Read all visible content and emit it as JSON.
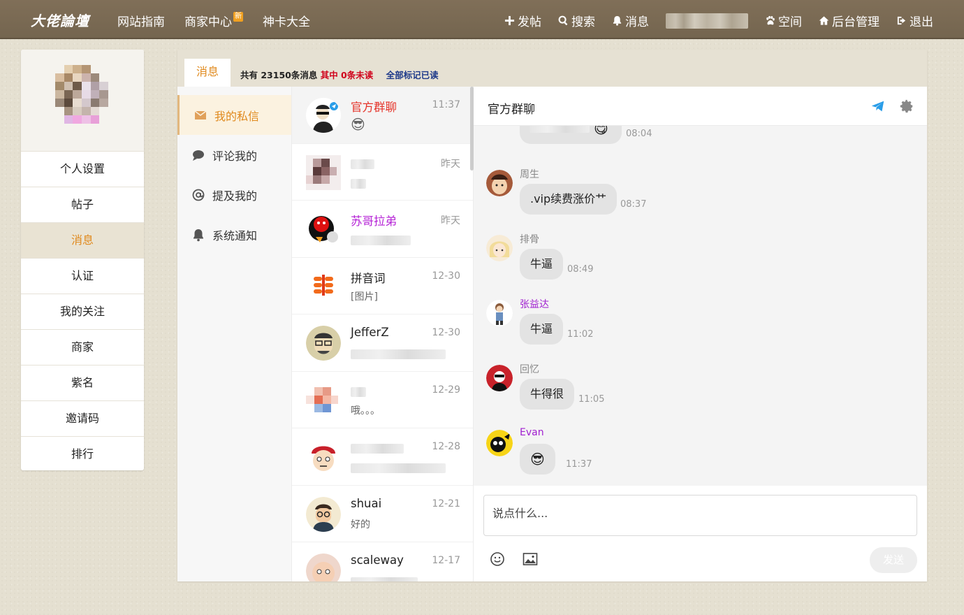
{
  "site": {
    "logo": "大佬論壇"
  },
  "nav_left": [
    {
      "label": "网站指南"
    },
    {
      "label": "商家中心",
      "badge": "新"
    },
    {
      "label": "神卡大全"
    }
  ],
  "nav_right": [
    {
      "label": "发帖",
      "icon": "plus-icon"
    },
    {
      "label": "搜索",
      "icon": "search-icon"
    },
    {
      "label": "消息",
      "icon": "bell-icon"
    },
    {
      "label": "空间",
      "icon": "paw-icon"
    },
    {
      "label": "后台管理",
      "icon": "home-icon"
    },
    {
      "label": "退出",
      "icon": "logout-icon"
    }
  ],
  "sidebar": {
    "items": [
      {
        "label": "个人设置"
      },
      {
        "label": "帖子"
      },
      {
        "label": "消息",
        "active": true
      },
      {
        "label": "认证"
      },
      {
        "label": "我的关注"
      },
      {
        "label": "商家"
      },
      {
        "label": "紫名"
      },
      {
        "label": "邀请码"
      },
      {
        "label": "排行"
      }
    ]
  },
  "header": {
    "tab": "消息",
    "stats_total": "共有 23150条消息",
    "stats_unread": "其中 0条未读",
    "mark_all_read": "全部标记已读"
  },
  "categories": [
    {
      "label": "我的私信",
      "icon": "envelope-icon",
      "active": true
    },
    {
      "label": "评论我的",
      "icon": "comment-icon"
    },
    {
      "label": "提及我的",
      "icon": "at-icon"
    },
    {
      "label": "系统通知",
      "icon": "bell-icon"
    }
  ],
  "conversations": [
    {
      "name": "官方群聊",
      "time": "11:37",
      "preview": "😎",
      "name_color": "#e5342a"
    },
    {
      "name": "",
      "time": "昨天",
      "preview": ""
    },
    {
      "name": "苏哥拉弟",
      "time": "昨天",
      "preview": "",
      "name_color": "#b522d6"
    },
    {
      "name": "拼音词",
      "time": "12-30",
      "preview": "[图片]"
    },
    {
      "name": "JefferZ",
      "time": "12-30",
      "preview": ""
    },
    {
      "name": "",
      "time": "12-29",
      "preview": "哦。。。"
    },
    {
      "name": "",
      "time": "12-28",
      "preview": ""
    },
    {
      "name": "shuai",
      "time": "12-21",
      "preview": "好的"
    },
    {
      "name": "scaleway",
      "time": "12-17",
      "preview": ""
    }
  ],
  "chat": {
    "title": "官方群聊",
    "messages": [
      {
        "name": "",
        "text": "",
        "time": "08:04"
      },
      {
        "name": "周生",
        "text": ".vip续费涨价艹",
        "time": "08:37"
      },
      {
        "name": "排骨",
        "text": "牛逼",
        "time": "08:49"
      },
      {
        "name": "张益达",
        "text": "牛逼",
        "time": "11:02",
        "name_color": "#a020d0"
      },
      {
        "name": "回忆",
        "text": "牛得很",
        "time": "11:05"
      },
      {
        "name": "Evan",
        "text": "😎",
        "time": "11:37",
        "name_color": "#a020d0"
      }
    ],
    "input_placeholder": "说点什么...",
    "send_label": "发送"
  },
  "colors": {
    "topbar": "#7a6b55",
    "accent_orange": "#e08a1e",
    "unread_red": "#d0021b",
    "mark_blue": "#1e3a8a",
    "purple_name": "#a020d0"
  }
}
